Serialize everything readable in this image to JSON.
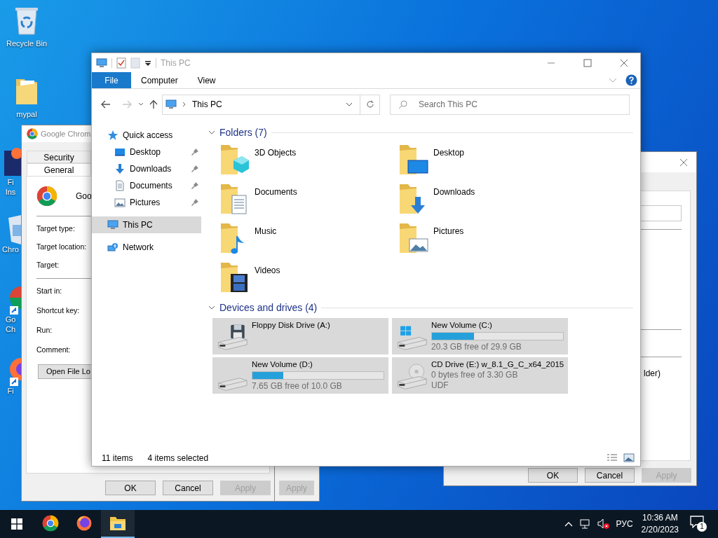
{
  "desktop_icons": [
    {
      "label": "Recycle Bin",
      "kind": "recycle"
    },
    {
      "label": "mypal",
      "kind": "folder"
    }
  ],
  "desktop_icons_partial": [
    {
      "lines": [
        "Fi",
        "Ins"
      ],
      "kind": "installer"
    },
    {
      "lines": [
        "Chro"
      ],
      "kind": "package"
    },
    {
      "lines": [
        "Go",
        "Ch"
      ],
      "kind": "chrome"
    },
    {
      "lines": [
        "Fi"
      ],
      "kind": "firefox"
    }
  ],
  "back_dialog": {
    "buttons": [
      {
        "label": "Apply",
        "disabled": true
      }
    ]
  },
  "shortcut_dialog": {
    "title": "Google Chrom",
    "tab_rows": [
      [
        {
          "label": "Security",
          "selected": false
        }
      ],
      [
        {
          "label": "General",
          "selected": true
        }
      ]
    ],
    "name": "Goo",
    "field_groups": [
      [
        "Target type:",
        "Target location:",
        "Target:"
      ],
      [
        "Start in:",
        "Shortcut key:",
        "Run:",
        "Comment:"
      ]
    ],
    "open_button": "Open File Lo",
    "buttons": [
      {
        "label": "OK",
        "disabled": false
      },
      {
        "label": "Cancel",
        "disabled": false
      },
      {
        "label": "Apply",
        "disabled": true
      }
    ]
  },
  "right_dialog": {
    "text": "lder)",
    "buttons": [
      {
        "label": "OK",
        "disabled": false
      },
      {
        "label": "Cancel",
        "disabled": false
      },
      {
        "label": "Apply",
        "disabled": true
      }
    ]
  },
  "explorer": {
    "title": "This PC",
    "active": false,
    "ribbon_tabs": [
      {
        "label": "File",
        "selected": true
      },
      {
        "label": "Computer",
        "selected": false
      },
      {
        "label": "View",
        "selected": false
      }
    ],
    "nav": {
      "back_disabled": false,
      "forward_disabled": true
    },
    "address": "This PC",
    "search": {
      "placeholder": "Search This PC"
    },
    "sidebar": [
      {
        "label": "Quick access",
        "kind": "star",
        "selected": false,
        "children": [
          {
            "label": "Desktop",
            "kind": "desktop",
            "selected": false,
            "pinned": true
          },
          {
            "label": "Downloads",
            "kind": "download",
            "selected": false,
            "pinned": true
          },
          {
            "label": "Documents",
            "kind": "document",
            "selected": false,
            "pinned": true
          },
          {
            "label": "Pictures",
            "kind": "pictures",
            "selected": false,
            "pinned": true
          }
        ]
      },
      {
        "label": "This PC",
        "kind": "pc",
        "selected": true
      },
      {
        "label": "Network",
        "kind": "network",
        "selected": false
      }
    ],
    "groups": [
      {
        "title": "Folders (7)",
        "kind": "folders",
        "expanded": true,
        "items": [
          {
            "label": "3D Objects",
            "kind": "cube"
          },
          {
            "label": "Desktop",
            "kind": "desktop"
          },
          {
            "label": "Documents",
            "kind": "document"
          },
          {
            "label": "Downloads",
            "kind": "download"
          },
          {
            "label": "Music",
            "kind": "music"
          },
          {
            "label": "Pictures",
            "kind": "pictures"
          },
          {
            "label": "Videos",
            "kind": "video"
          }
        ]
      },
      {
        "title": "Devices and drives (4)",
        "kind": "drives",
        "expanded": true,
        "items": [
          {
            "name": "Floppy Disk Drive (A:)",
            "kind": "floppy",
            "selected": true
          },
          {
            "name": "New Volume (C:)",
            "kind": "system",
            "selected": true,
            "level": 0.32,
            "free": "20.3 GB free of 29.9 GB"
          },
          {
            "name": "New Volume (D:)",
            "kind": "disk",
            "selected": true,
            "level": 0.235,
            "free": "7.65 GB free of 10.0 GB"
          },
          {
            "name": "CD Drive (E:) w_8.1_G_C_x64_2015",
            "kind": "cd",
            "selected": true,
            "free": "0 bytes free of 3.30 GB",
            "filesystem": "UDF"
          }
        ]
      }
    ],
    "status": [
      "11 items",
      "4 items selected"
    ]
  },
  "taskbar": {
    "apps": [
      {
        "kind": "chrome",
        "active": false
      },
      {
        "kind": "firefox",
        "active": false
      },
      {
        "kind": "explorer",
        "active": true
      }
    ],
    "volume_muted": true,
    "language": "РУС",
    "time": "10:36 AM",
    "date": "2/20/2023",
    "notifications": "1"
  }
}
